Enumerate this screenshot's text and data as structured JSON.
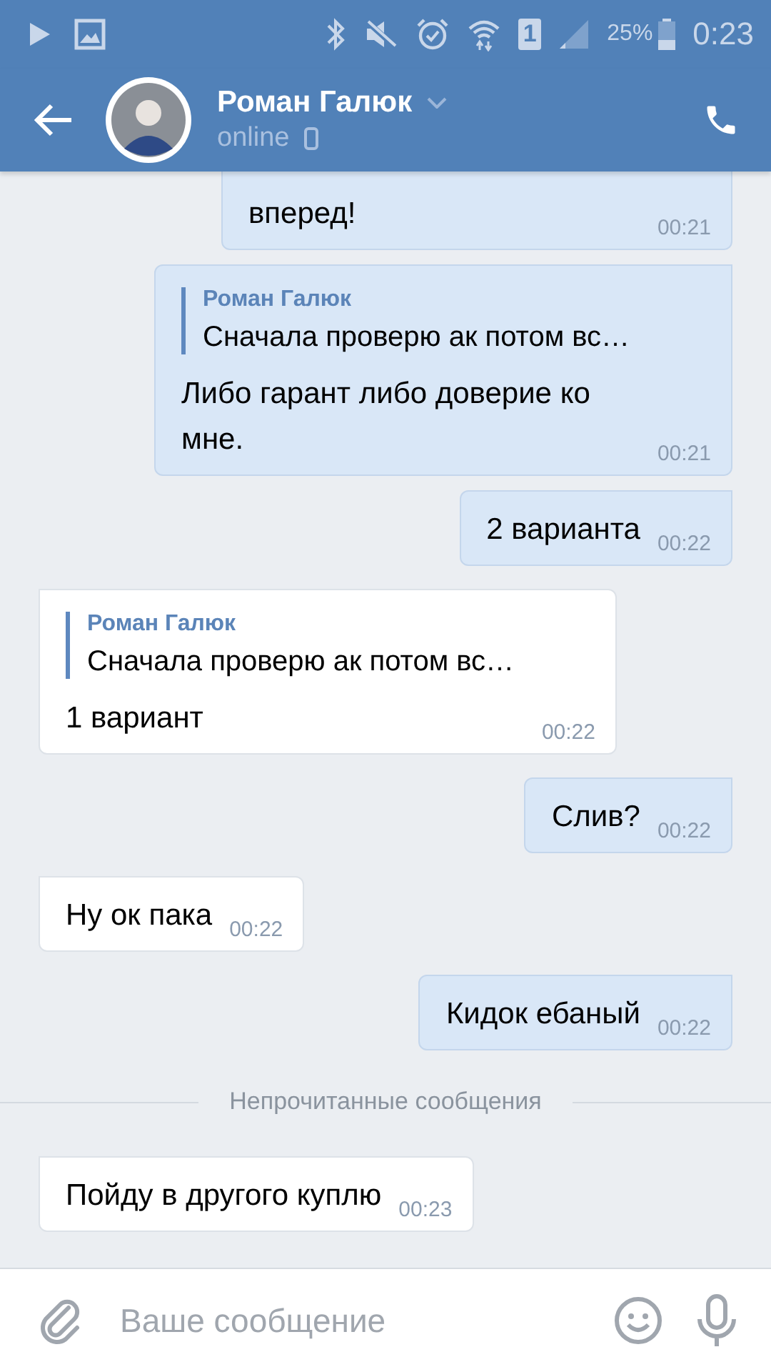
{
  "status_bar": {
    "sim_slot": "1",
    "battery": "25%",
    "time": "0:23"
  },
  "header": {
    "name": "Роман Галюк",
    "status": "online"
  },
  "messages": [
    {
      "kind": "message",
      "outgoing": true,
      "text": "вперед!",
      "time": "00:21"
    },
    {
      "kind": "message",
      "outgoing": true,
      "reply": {
        "author": "Роман Галюк",
        "text": "Сначала проверю ак потом вс…"
      },
      "text": "Либо гарант либо доверие ко мне.",
      "time": "00:21"
    },
    {
      "kind": "message",
      "outgoing": true,
      "text": "2 варианта",
      "time": "00:22"
    },
    {
      "kind": "message",
      "outgoing": false,
      "reply": {
        "author": "Роман Галюк",
        "text": "Сначала проверю ак потом вс…"
      },
      "text": "1 вариант",
      "time": "00:22"
    },
    {
      "kind": "message",
      "outgoing": true,
      "text": "Слив?",
      "time": "00:22"
    },
    {
      "kind": "message",
      "outgoing": false,
      "text": "Ну ок пака",
      "time": "00:22"
    },
    {
      "kind": "message",
      "outgoing": true,
      "text": "Кидок ебаный",
      "time": "00:22"
    },
    {
      "kind": "divider",
      "text": "Непрочитанные сообщения"
    },
    {
      "kind": "message",
      "outgoing": false,
      "text": "Пойду в другого куплю",
      "time": "00:23"
    }
  ],
  "composer": {
    "placeholder": "Ваше сообщение"
  }
}
